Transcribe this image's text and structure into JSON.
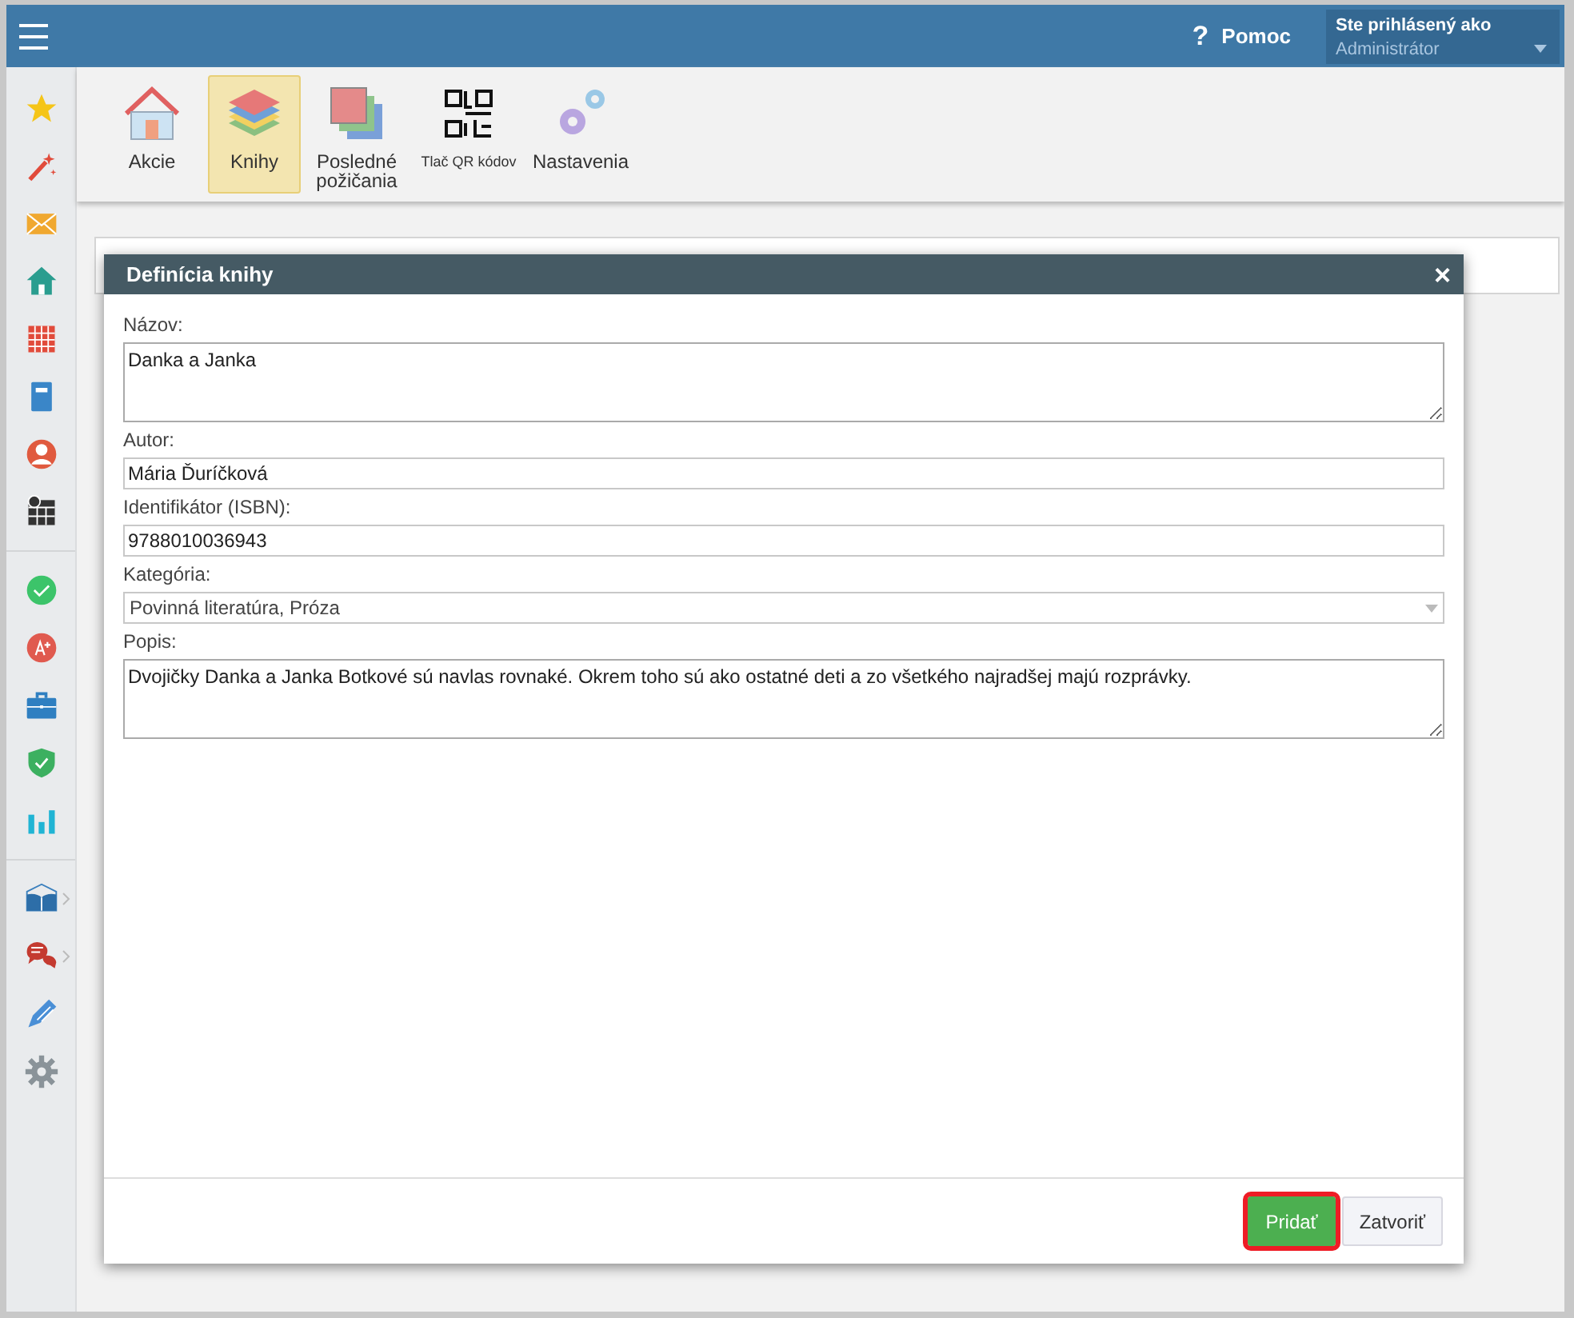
{
  "header": {
    "help": {
      "icon": "?",
      "label": "Pomoc"
    },
    "user": {
      "caption": "Ste prihlásený ako",
      "name": "Administrátor"
    }
  },
  "toolbar": [
    {
      "label": "Akcie",
      "kind": "normal",
      "selected": false
    },
    {
      "label": "Knihy",
      "kind": "normal",
      "selected": true
    },
    {
      "label": "Posledné požičania",
      "kind": "normal",
      "selected": false
    },
    {
      "label": "Tlač QR kódov",
      "kind": "compact",
      "selected": false
    },
    {
      "label": "Nastavenia",
      "kind": "normal",
      "selected": false
    }
  ],
  "dialog": {
    "title": "Definícia knihy",
    "close": "×",
    "fields": [
      {
        "label": "Názov:",
        "kind": "textarea",
        "value": "Danka a Janka"
      },
      {
        "label": "Autor:",
        "kind": "text",
        "value": "Mária Ďuríčková"
      },
      {
        "label": "Identifikátor (ISBN):",
        "kind": "text",
        "value": "9788010036943"
      },
      {
        "label": "Kategória:",
        "kind": "select",
        "value": "Povinná literatúra, Próza"
      },
      {
        "label": "Popis:",
        "kind": "textarea",
        "value": "Dvojičky Danka a Janka Botkové sú navlas rovnaké. Okrem toho sú ako ostatné deti a zo všetkého najradšej majú rozprávky."
      }
    ],
    "buttons": [
      {
        "label": "Pridať",
        "kind": "primary",
        "highlighted": true
      },
      {
        "label": "Zatvoriť",
        "kind": "secondary",
        "highlighted": false
      }
    ]
  }
}
